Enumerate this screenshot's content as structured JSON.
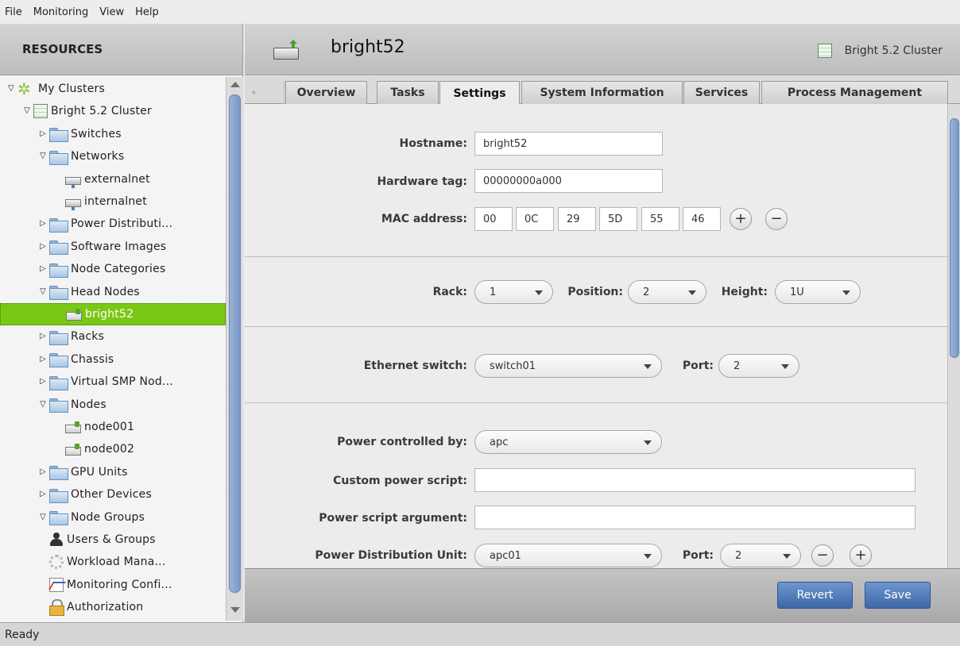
{
  "menu": [
    "File",
    "Monitoring",
    "View",
    "Help"
  ],
  "sidebar": {
    "header": "RESOURCES",
    "tree": [
      {
        "label": "My Clusters",
        "twisty": "open",
        "icon": "cluster-dots-icon"
      },
      {
        "label": "Bright 5.2 Cluster",
        "twisty": "open",
        "icon": "cluster-icon"
      },
      {
        "label": "Switches",
        "twisty": "closed",
        "icon": "folder-icon"
      },
      {
        "label": "Networks",
        "twisty": "open",
        "icon": "folder-icon"
      },
      {
        "label": "externalnet",
        "twisty": "none",
        "icon": "network-icon"
      },
      {
        "label": "internalnet",
        "twisty": "none",
        "icon": "network-icon"
      },
      {
        "label": "Power Distributi...",
        "twisty": "closed",
        "icon": "folder-icon"
      },
      {
        "label": "Software Images",
        "twisty": "closed",
        "icon": "folder-icon"
      },
      {
        "label": "Node Categories",
        "twisty": "closed",
        "icon": "folder-icon"
      },
      {
        "label": "Head Nodes",
        "twisty": "open",
        "icon": "folder-icon"
      },
      {
        "label": "bright52",
        "twisty": "none",
        "icon": "node-icon",
        "selected": true
      },
      {
        "label": "Racks",
        "twisty": "closed",
        "icon": "folder-icon"
      },
      {
        "label": "Chassis",
        "twisty": "closed",
        "icon": "folder-icon"
      },
      {
        "label": "Virtual SMP Nod...",
        "twisty": "closed",
        "icon": "folder-icon"
      },
      {
        "label": "Nodes",
        "twisty": "open",
        "icon": "folder-icon"
      },
      {
        "label": "node001",
        "twisty": "none",
        "icon": "node-icon"
      },
      {
        "label": "node002",
        "twisty": "none",
        "icon": "node-icon"
      },
      {
        "label": "GPU Units",
        "twisty": "closed",
        "icon": "folder-icon"
      },
      {
        "label": "Other Devices",
        "twisty": "closed",
        "icon": "folder-icon"
      },
      {
        "label": "Node Groups",
        "twisty": "open",
        "icon": "folder-icon"
      },
      {
        "label": "Users & Groups",
        "twisty": "none",
        "icon": "users-icon"
      },
      {
        "label": "Workload Mana...",
        "twisty": "none",
        "icon": "gear-icon"
      },
      {
        "label": "Monitoring Confi...",
        "twisty": "none",
        "icon": "chart-icon"
      },
      {
        "label": "Authorization",
        "twisty": "none",
        "icon": "lock-icon"
      }
    ]
  },
  "header": {
    "title": "bright52",
    "cluster": "Bright 5.2 Cluster"
  },
  "tabs": [
    "Overview",
    "Tasks",
    "Settings",
    "System Information",
    "Services",
    "Process Management"
  ],
  "active_tab": "Settings",
  "form": {
    "hostname_label": "Hostname:",
    "hostname": "bright52",
    "hwtag_label": "Hardware tag:",
    "hwtag": "00000000a000",
    "mac_label": "MAC address:",
    "mac": [
      "00",
      "0C",
      "29",
      "5D",
      "55",
      "46"
    ],
    "rack_label": "Rack:",
    "rack": "1",
    "position_label": "Position:",
    "position": "2",
    "height_label": "Height:",
    "height": "1U",
    "eth_label": "Ethernet switch:",
    "eth": "switch01",
    "port_label": "Port:",
    "eth_port": "2",
    "power_label": "Power controlled by:",
    "power": "apc",
    "custom_label": "Custom power script:",
    "custom": "",
    "arg_label": "Power script argument:",
    "arg": "",
    "pdu_label": "Power Distribution Unit:",
    "pdu": "apc01",
    "pdu_port": "2"
  },
  "buttons": {
    "revert": "Revert",
    "save": "Save"
  },
  "status": "Ready"
}
